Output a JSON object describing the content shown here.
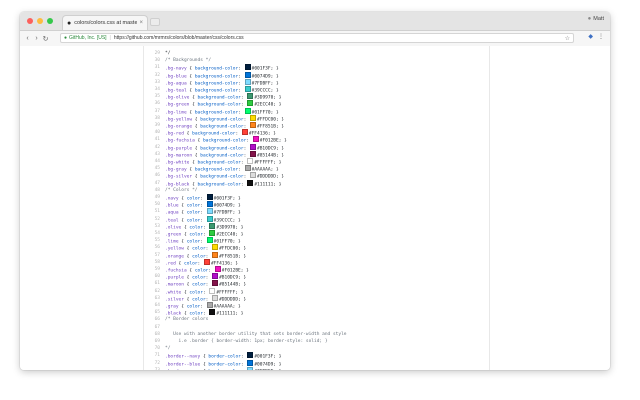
{
  "browser": {
    "tab_title": "colors/colors.css at master",
    "tab_close": "×",
    "profile_name": "Matt",
    "secure_label": "GitHub, Inc. [US]",
    "url": "https://github.com/mrmrs/colors/blob/master/css/colors.css"
  },
  "lines": [
    {
      "n": "29",
      "t": "plain",
      "text": "*/"
    },
    {
      "n": "30",
      "t": "comment",
      "text": "/* Backgrounds */"
    },
    {
      "n": "31",
      "t": "rule",
      "sel": ".bg-navy",
      "prop": "background-color",
      "color": "#001f3f",
      "val": "#001F3F"
    },
    {
      "n": "32",
      "t": "rule",
      "sel": ".bg-blue",
      "prop": "background-color",
      "color": "#0074d9",
      "val": "#0074D9"
    },
    {
      "n": "33",
      "t": "rule",
      "sel": ".bg-aqua",
      "prop": "background-color",
      "color": "#7fdbff",
      "val": "#7FDBFF"
    },
    {
      "n": "34",
      "t": "rule",
      "sel": ".bg-teal",
      "prop": "background-color",
      "color": "#39cccc",
      "val": "#39CCCC"
    },
    {
      "n": "35",
      "t": "rule",
      "sel": ".bg-olive",
      "prop": "background-color",
      "color": "#3d9970",
      "val": "#3D9970"
    },
    {
      "n": "36",
      "t": "rule",
      "sel": ".bg-green",
      "prop": "background-color",
      "color": "#2ecc40",
      "val": "#2ECC40"
    },
    {
      "n": "37",
      "t": "rule",
      "sel": ".bg-lime",
      "prop": "background-color",
      "color": "#01ff70",
      "val": "#01FF70"
    },
    {
      "n": "38",
      "t": "rule",
      "sel": ".bg-yellow",
      "prop": "background-color",
      "color": "#ffdc00",
      "val": "#FFDC00"
    },
    {
      "n": "39",
      "t": "rule",
      "sel": ".bg-orange",
      "prop": "background-color",
      "color": "#ff851b",
      "val": "#FF851B"
    },
    {
      "n": "40",
      "t": "rule",
      "sel": ".bg-red",
      "prop": "background-color",
      "color": "#ff4136",
      "val": "#FF4136"
    },
    {
      "n": "41",
      "t": "rule",
      "sel": ".bg-fuchsia",
      "prop": "background-color",
      "color": "#f012be",
      "val": "#F012BE"
    },
    {
      "n": "42",
      "t": "rule",
      "sel": ".bg-purple",
      "prop": "background-color",
      "color": "#b10dc9",
      "val": "#B10DC9"
    },
    {
      "n": "43",
      "t": "rule",
      "sel": ".bg-maroon",
      "prop": "background-color",
      "color": "#85144b",
      "val": "#85144B"
    },
    {
      "n": "44",
      "t": "rule",
      "sel": ".bg-white",
      "prop": "background-color",
      "color": "#ffffff",
      "val": "#FFFFFF"
    },
    {
      "n": "45",
      "t": "rule",
      "sel": ".bg-gray",
      "prop": "background-color",
      "color": "#aaaaaa",
      "val": "#AAAAAA"
    },
    {
      "n": "46",
      "t": "rule",
      "sel": ".bg-silver",
      "prop": "background-color",
      "color": "#dddddd",
      "val": "#DDDDDD"
    },
    {
      "n": "47",
      "t": "rule",
      "sel": ".bg-black",
      "prop": "background-color",
      "color": "#111111",
      "val": "#111111"
    },
    {
      "n": "48",
      "t": "comment",
      "text": "/* Colors */"
    },
    {
      "n": "49",
      "t": "rule",
      "sel": ".navy",
      "prop": "color",
      "color": "#001f3f",
      "val": "#001F3F"
    },
    {
      "n": "50",
      "t": "rule",
      "sel": ".blue",
      "prop": "color",
      "color": "#0074d9",
      "val": "#0074D9"
    },
    {
      "n": "51",
      "t": "rule",
      "sel": ".aqua",
      "prop": "color",
      "color": "#7fdbff",
      "val": "#7FDBFF"
    },
    {
      "n": "52",
      "t": "rule",
      "sel": ".teal",
      "prop": "color",
      "color": "#39cccc",
      "val": "#39CCCC"
    },
    {
      "n": "53",
      "t": "rule",
      "sel": ".olive",
      "prop": "color",
      "color": "#3d9970",
      "val": "#3D9970"
    },
    {
      "n": "54",
      "t": "rule",
      "sel": ".green",
      "prop": "color",
      "color": "#2ecc40",
      "val": "#2ECC40"
    },
    {
      "n": "55",
      "t": "rule",
      "sel": ".lime",
      "prop": "color",
      "color": "#01ff70",
      "val": "#01FF70"
    },
    {
      "n": "56",
      "t": "rule",
      "sel": ".yellow",
      "prop": "color",
      "color": "#ffdc00",
      "val": "#FFDC00"
    },
    {
      "n": "57",
      "t": "rule",
      "sel": ".orange",
      "prop": "color",
      "color": "#ff851b",
      "val": "#FF851B"
    },
    {
      "n": "58",
      "t": "rule",
      "sel": ".red",
      "prop": "color",
      "color": "#ff4136",
      "val": "#FF4136"
    },
    {
      "n": "59",
      "t": "rule",
      "sel": ".fuchsia",
      "prop": "color",
      "color": "#f012be",
      "val": "#F012BE"
    },
    {
      "n": "60",
      "t": "rule",
      "sel": ".purple",
      "prop": "color",
      "color": "#b10dc9",
      "val": "#B10DC9"
    },
    {
      "n": "61",
      "t": "rule",
      "sel": ".maroon",
      "prop": "color",
      "color": "#85144b",
      "val": "#85144B"
    },
    {
      "n": "62",
      "t": "rule",
      "sel": ".white",
      "prop": "color",
      "color": "#ffffff",
      "val": "#FFFFFF"
    },
    {
      "n": "63",
      "t": "rule",
      "sel": ".silver",
      "prop": "color",
      "color": "#dddddd",
      "val": "#DDDDDD"
    },
    {
      "n": "64",
      "t": "rule",
      "sel": ".gray",
      "prop": "color",
      "color": "#aaaaaa",
      "val": "#AAAAAA"
    },
    {
      "n": "65",
      "t": "rule",
      "sel": ".black",
      "prop": "color",
      "color": "#111111",
      "val": "#111111"
    },
    {
      "n": "66",
      "t": "comment",
      "text": "/* Border colors"
    },
    {
      "n": "67",
      "t": "plain",
      "text": ""
    },
    {
      "n": "68",
      "t": "comment",
      "text": "   Use with another border utility that sets border-width and style"
    },
    {
      "n": "69",
      "t": "comment",
      "text": "     i.e .border { border-width: 1px; border-style: solid; }"
    },
    {
      "n": "70",
      "t": "comment",
      "text": "*/"
    },
    {
      "n": "71",
      "t": "rule",
      "sel": ".border--navy",
      "prop": "border-color",
      "color": "#001f3f",
      "val": "#001F3F"
    },
    {
      "n": "72",
      "t": "rule",
      "sel": ".border--blue",
      "prop": "border-color",
      "color": "#0074d9",
      "val": "#0074D9"
    },
    {
      "n": "73",
      "t": "rule",
      "sel": ".border--aqua",
      "prop": "border-color",
      "color": "#7fdbff",
      "val": "#7FDBFF"
    },
    {
      "n": "74",
      "t": "rule",
      "sel": ".border--teal",
      "prop": "border-color",
      "color": "#39cccc",
      "val": "#39CCCC"
    },
    {
      "n": "75",
      "t": "rule",
      "sel": ".border--olive",
      "prop": "border-color",
      "color": "#3d9970",
      "val": "#3D9970"
    }
  ]
}
